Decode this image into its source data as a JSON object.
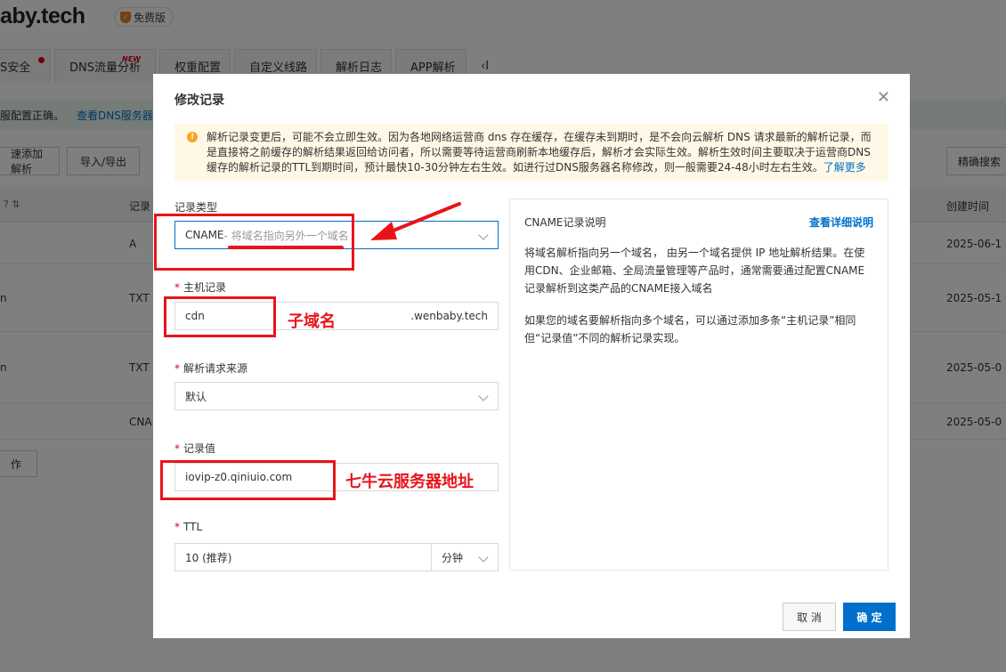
{
  "page": {
    "brand": "aby.tech",
    "badge_label": "免费版",
    "tabs": [
      {
        "label": "S安全",
        "has_dot": true
      },
      {
        "label": "DNS流量分析",
        "flag": "NEW"
      },
      {
        "label": "权重配置"
      },
      {
        "label": "自定义线路"
      },
      {
        "label": "解析日志"
      },
      {
        "label": "APP解析"
      }
    ],
    "tabs_more": "‹I",
    "notice_text": "服配置正确。",
    "notice_link": "查看DNS服务器",
    "toolbar": {
      "quick_add": "速添加解析",
      "import_export": "导入/导出",
      "precise_search": "精确搜索"
    },
    "table": {
      "record_type_header": "记录",
      "created_header": "创建时间",
      "rows": [
        {
          "host": "",
          "type": "A",
          "created": "2025-06-1"
        },
        {
          "host": "n",
          "type": "TXT",
          "created": "2025-05-1"
        },
        {
          "host": "n",
          "type": "TXT",
          "created": "2025-05-0"
        },
        {
          "host": "",
          "type": "CNA",
          "created": "2025-05-0"
        }
      ],
      "batch_action": "作"
    }
  },
  "dialog": {
    "title": "修改记录",
    "alert": {
      "text": "解析记录变更后，可能不会立即生效。因为各地网络运营商 dns 存在缓存，在缓存未到期时，是不会向云解析 DNS 请求最新的解析记录，而是直接将之前缓存的解析结果返回给访问者，所以需要等待运营商刷新本地缓存后，解析才会实际生效。解析生效时间主要取决于运营商DNS缓存的解析记录的TTL到期时间，预计最快10-30分钟左右生效。如进行过DNS服务器名称修改，则一般需要24-48小时左右生效。",
      "more_link": "了解更多"
    },
    "record_type": {
      "label": "记录类型",
      "value": "CNAME",
      "hint": "- 将域名指向另外一个域名"
    },
    "host": {
      "label": "主机记录",
      "value": "cdn",
      "suffix": ".wenbaby.tech"
    },
    "source": {
      "label": "解析请求来源",
      "value": "默认"
    },
    "record_value": {
      "label": "记录值",
      "value": "iovip-z0.qiniuio.com"
    },
    "ttl": {
      "label": "TTL",
      "value": "10 (推荐)",
      "unit": "分钟"
    },
    "help": {
      "title": "CNAME记录说明",
      "link": "查看详细说明",
      "p1": "将域名解析指向另一个域名， 由另一个域名提供 IP 地址解析结果。在使用CDN、企业邮箱、全局流量管理等产品时，通常需要通过配置CNAME记录解析到这类产品的CNAME接入域名",
      "p2": "如果您的域名要解析指向多个域名，可以通过添加多条“主机记录”相同但“记录值”不同的解析记录实现。"
    },
    "cancel_label": "取 消",
    "confirm_label": "确 定"
  },
  "annotations": {
    "subdomain": "子域名",
    "qiniu_server": "七牛云服务器地址"
  },
  "colors": {
    "accent": "#0070cc",
    "annotation_red": "#e8141b",
    "alert_bg": "#fff8e6",
    "notice_bg": "#eaf6ed"
  }
}
